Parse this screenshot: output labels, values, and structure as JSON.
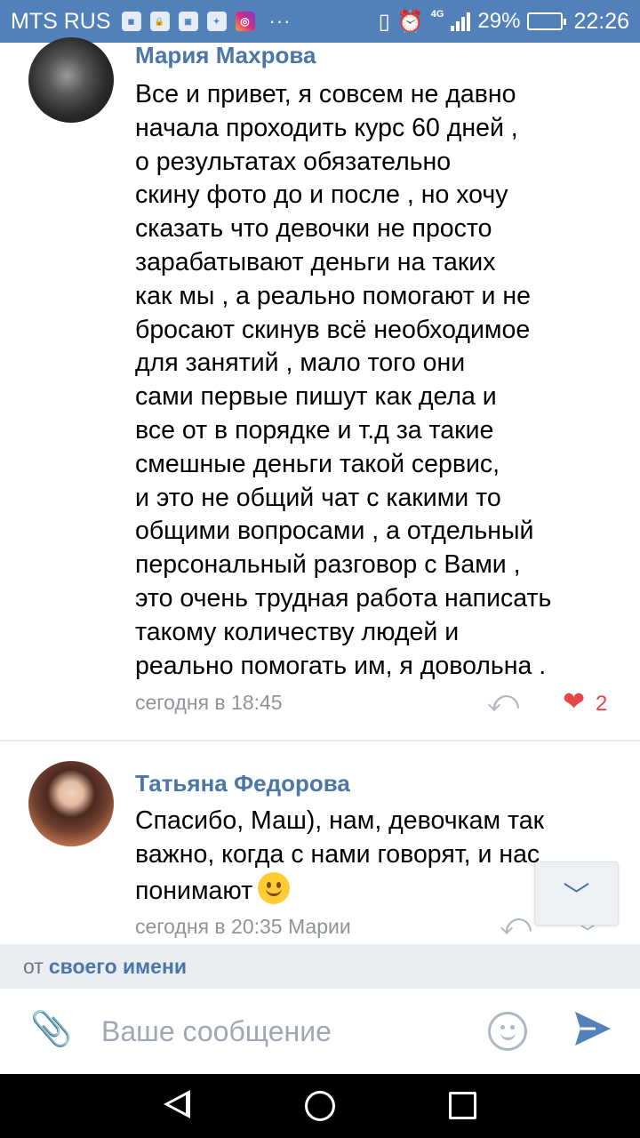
{
  "status_bar": {
    "carrier": "MTS RUS",
    "app_icons": [
      "tele2-icon",
      "lock-app-icon",
      "gallery-icon",
      "photo-icon",
      "instagram-icon"
    ],
    "overflow": "···",
    "network": "4G",
    "battery": "29%",
    "battery_level": 0.29,
    "time": "22:26"
  },
  "comments": [
    {
      "author": "Мария Махрова",
      "lines": [
        "Все и привет, я совсем не давно",
        "начала проходить курс 60 дней ,",
        "о результатах обязательно",
        "скину фото до и после , но хочу",
        "сказать что девочки не просто",
        "зарабатывают деньги на таких",
        "как мы , а реально помогают и не",
        "бросают скинув всё необходимое",
        "для занятий , мало того они",
        "сами первые пишут как дела и",
        "все от в порядке и т.д за такие",
        "смешные деньги такой сервис,",
        "и это не общий чат с какими то",
        "общими вопросами , а отдельный",
        "персональный разговор с Вами ,",
        "это очень трудная работа написать",
        "такому количеству людей и",
        "реально помогать им, я довольна ."
      ],
      "time": "сегодня в 18:45",
      "likes": "2"
    },
    {
      "author": "Татьяна Федорова",
      "lines": [
        "Спасибо, Маш), нам, девочкам так",
        "важно, когда с нами говорят, и нас",
        "понимают"
      ],
      "time": "сегодня в 20:35 Марии"
    }
  ],
  "from_bar": {
    "prefix": "от",
    "link": "своего имени"
  },
  "compose": {
    "placeholder": "Ваше сообщение"
  },
  "colors": {
    "accent": "#5181b8",
    "link": "#4a76a8",
    "like": "#e64646",
    "meta": "#909499"
  }
}
